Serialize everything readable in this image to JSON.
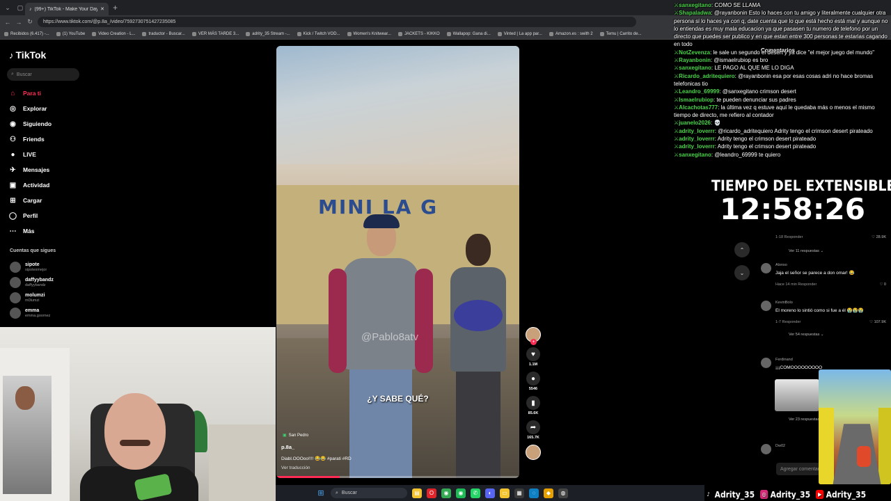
{
  "browser": {
    "tab_title": "(99+) TikTok - Make Your Day",
    "url": "https://www.tiktok.com/@p.8a_/video/7592730751427235085",
    "bookmarks": [
      "Recibidos (6.417) -...",
      "(1) YouTube",
      "Video Creation - L...",
      "traductor - Buscar...",
      "VER MÁS TARDE 3...",
      "adrity_35 Stream -...",
      "Kick / Twitch VOD...",
      "Women's Knitwear...",
      "JACKETS - KIKKO",
      "Wallapop: Gana di...",
      "Vinted | La app par...",
      "Amazon.es : swith 2",
      "Temu | Carrito de..."
    ]
  },
  "tiktok": {
    "logo": "TikTok",
    "search_placeholder": "Buscar",
    "nav": [
      {
        "label": "Para ti",
        "icon": "home-icon",
        "glyph": "⌂",
        "active": true
      },
      {
        "label": "Explorar",
        "icon": "compass-icon",
        "glyph": "◎",
        "active": false
      },
      {
        "label": "Siguiendo",
        "icon": "following-icon",
        "glyph": "◉",
        "active": false
      },
      {
        "label": "Friends",
        "icon": "friends-icon",
        "glyph": "⚇",
        "active": false
      },
      {
        "label": "LIVE",
        "icon": "live-icon",
        "glyph": "●",
        "active": false
      },
      {
        "label": "Mensajes",
        "icon": "messages-icon",
        "glyph": "✈",
        "active": false
      },
      {
        "label": "Actividad",
        "icon": "activity-icon",
        "glyph": "▣",
        "active": false
      },
      {
        "label": "Cargar",
        "icon": "upload-icon",
        "glyph": "⊞",
        "active": false
      },
      {
        "label": "Perfil",
        "icon": "profile-icon",
        "glyph": "◯",
        "active": false
      },
      {
        "label": "Más",
        "icon": "more-icon",
        "glyph": "⋯",
        "active": false
      }
    ],
    "following_title": "Cuentas que sigues",
    "following": [
      {
        "name": "sipote",
        "user": "sipotexmejor"
      },
      {
        "name": "daffyybandz",
        "user": "daffyybandz"
      },
      {
        "name": "molumzi",
        "user": "m0lumzi"
      },
      {
        "name": "emma",
        "user": "emma.goomez"
      }
    ],
    "video": {
      "watermark": "@Pablo8atv",
      "sign": "MINI  LA G",
      "subtitle": "¿Y SABE QUÉ?",
      "location": "San Pedro",
      "username": "p.8a_",
      "caption": "Diabl.OOOoo!!!! 😂😂 #parati #RD",
      "translate": "Ver traducción",
      "progress": 0.26
    },
    "actions": [
      {
        "name": "like-button",
        "icon": "heart-icon",
        "glyph": "♥",
        "count": "1.1M"
      },
      {
        "name": "comment-button",
        "icon": "comment-icon",
        "glyph": "●",
        "count": "5546"
      },
      {
        "name": "save-button",
        "icon": "bookmark-icon",
        "glyph": "▮",
        "count": "85.6K"
      },
      {
        "name": "share-button",
        "icon": "share-icon",
        "glyph": "➦",
        "count": "165.7K"
      }
    ],
    "comments": {
      "title": "Comentarios",
      "items": [
        {
          "name": "Alonso",
          "text": "Jaja el señor se parece a don omar! 😂",
          "meta": "Hace 14 min  Responder",
          "likes": "♡ 0",
          "replies": ""
        },
        {
          "name": "KevinBolo",
          "text": "El moreno lo sintió como si fue a él 😭😭😭",
          "meta": "1-7  Responder",
          "likes": "♡ 107.9K",
          "replies": "Ver 54 respuestas ⌄"
        },
        {
          "name": "Ferdinand",
          "text": "¡¡¡COMOOOOOOOOO",
          "meta": "1-8  Responder",
          "likes": "",
          "replies": "Ver 23 respuestas"
        },
        {
          "name": "Dw02",
          "text": "",
          "meta": "",
          "likes": "",
          "replies": ""
        }
      ],
      "earlier": {
        "meta": "1-18  Responder",
        "likes": "♡ 28.9K",
        "replies": "Ver 11 respuestas ⌄"
      },
      "input_placeholder": "Agregar comentario..."
    }
  },
  "stream": {
    "chat": [
      {
        "user": "sanxegitano",
        "msg": "COMO SE LLAMA"
      },
      {
        "user": "Shapaladwa",
        "msg": "@rayanbonin Esto lo haces con tu amigo y literalmente cualquier otra persona si lo haces ya con q, date cuenta que lo que está hecho está mal y aunque no lo entiendas es muy mala educacion ya que pasasen tu numero de telefono por un directo que puedes ser publico y en que estan entre 300 personas te estarias cagando en todo"
      },
      {
        "user": "NotZevenza",
        "msg": "le sale un segundo el desert y ya dice \"el mejor juego del mundo\""
      },
      {
        "user": "Rayanbonin",
        "msg": "@ismaelrubiop es bro"
      },
      {
        "user": "sanxegitano",
        "msg": "LE PAGO AL QUE ME LO DIGA"
      },
      {
        "user": "Ricardo_adritequiero",
        "msg": "@rayanbonin esa por esas cosas adri no hace bromas telefonicas tio"
      },
      {
        "user": "Leandro_69999",
        "msg": "@sanxegitano crimson desert"
      },
      {
        "user": "Ismaelrubiop",
        "msg": "te pueden denunciar sus padres"
      },
      {
        "user": "Alcachotas777",
        "msg": "la última vez q estuve aquí le quedaba más o menos el mismo tiempo de directo, me refiero al contador"
      },
      {
        "user": "juanelo2026",
        "msg": "💀"
      },
      {
        "user": "adrity_loverrr",
        "msg": "@ricardo_adritequiero Adrity tengo el crimson desert pirateado"
      },
      {
        "user": "adrity_loverrr",
        "msg": "Adrity tengo el crimson desert pirateado"
      },
      {
        "user": "adrity_loverrr",
        "msg": "Adrity tengo el crimson desert pirateado"
      },
      {
        "user": "sanxegitano",
        "msg": "@leandro_69999 te quiero"
      }
    ],
    "timer_label": "TIEMPO DEL EXTENSIBLE:",
    "timer": "12:58:26",
    "socials": [
      {
        "icon": "tiktok-icon",
        "glyph": "♪",
        "handle": "Adrity_35",
        "color": "#000000"
      },
      {
        "icon": "instagram-icon",
        "glyph": "◎",
        "handle": "Adrity_35",
        "color": "#d62976"
      },
      {
        "icon": "youtube-icon",
        "glyph": "▶",
        "handle": "Adrity_35",
        "color": "#ff0000"
      }
    ]
  },
  "taskbar": {
    "search_placeholder": "Buscar",
    "apps": [
      {
        "icon": "file-explorer-icon",
        "glyph": "▤",
        "color": "#f4c430"
      },
      {
        "icon": "opera-icon",
        "glyph": "O",
        "color": "#e0242a"
      },
      {
        "icon": "chrome-icon",
        "glyph": "◉",
        "color": "#34a853"
      },
      {
        "icon": "spotify-icon",
        "glyph": "◉",
        "color": "#1db954"
      },
      {
        "icon": "whatsapp-icon",
        "glyph": "✆",
        "color": "#25d366"
      },
      {
        "icon": "discord-icon",
        "glyph": "◐",
        "color": "#5865f2"
      },
      {
        "icon": "folder-icon",
        "glyph": "▭",
        "color": "#f4c430"
      },
      {
        "icon": "store-icon",
        "glyph": "▦",
        "color": "#3a3a3a"
      },
      {
        "icon": "edge-icon",
        "glyph": "◌",
        "color": "#0f7fc2"
      },
      {
        "icon": "app-icon",
        "glyph": "◆",
        "color": "#e6a100"
      },
      {
        "icon": "obs-icon",
        "glyph": "◍",
        "color": "#444444"
      }
    ]
  }
}
